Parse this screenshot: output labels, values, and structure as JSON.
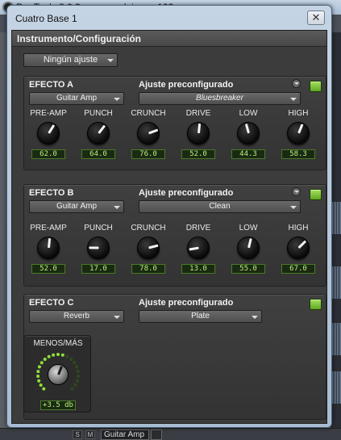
{
  "background_window": {
    "title": "Pro Tools 8.0.3 - amores lejanos 102",
    "bottom_insert_label": "Guitar Amp",
    "bottom_btn_s": "S",
    "bottom_btn_m": "M"
  },
  "plugin_window": {
    "title": "Cuatro Base 1",
    "close_glyph": "✕",
    "header": "Instrumento/Configuración",
    "preset_top": "Ningún ajuste"
  },
  "colors": {
    "power_on": "#7ec83a",
    "lcd_text": "#b8f07a",
    "panel_bg": "#3c3c3c"
  },
  "effects": [
    {
      "title": "EFECTO A",
      "preset_label": "Ajuste preconfigurado",
      "type": "Guitar Amp",
      "preset": "Bluesbreaker",
      "preset_italic": true,
      "power": "on",
      "knobs": [
        {
          "label": "PRE-AMP",
          "value": "62.0",
          "level": 0.62
        },
        {
          "label": "PUNCH",
          "value": "64.0",
          "level": 0.64
        },
        {
          "label": "CRUNCH",
          "value": "76.0",
          "level": 0.76
        },
        {
          "label": "DRIVE",
          "value": "52.0",
          "level": 0.52
        },
        {
          "label": "LOW",
          "value": "44.3",
          "level": 0.443
        },
        {
          "label": "HIGH",
          "value": "58.3",
          "level": 0.583
        }
      ]
    },
    {
      "title": "EFECTO B",
      "preset_label": "Ajuste preconfigurado",
      "type": "Guitar Amp",
      "preset": "Clean",
      "preset_italic": false,
      "power": "on",
      "knobs": [
        {
          "label": "PRE-AMP",
          "value": "52.0",
          "level": 0.52
        },
        {
          "label": "PUNCH",
          "value": "17.0",
          "level": 0.17
        },
        {
          "label": "CRUNCH",
          "value": "78.0",
          "level": 0.78
        },
        {
          "label": "DRIVE",
          "value": "13.0",
          "level": 0.13
        },
        {
          "label": "LOW",
          "value": "55.0",
          "level": 0.55
        },
        {
          "label": "HIGH",
          "value": "67.0",
          "level": 0.67
        }
      ]
    },
    {
      "title": "EFECTO C",
      "preset_label": "Ajuste preconfigurado",
      "type": "Reverb",
      "preset": "Plate",
      "preset_italic": false,
      "power": "on",
      "knobs": []
    }
  ],
  "menos_mas": {
    "label": "MENOS/MÁS",
    "value": "+3.5 db",
    "level": 0.58
  }
}
